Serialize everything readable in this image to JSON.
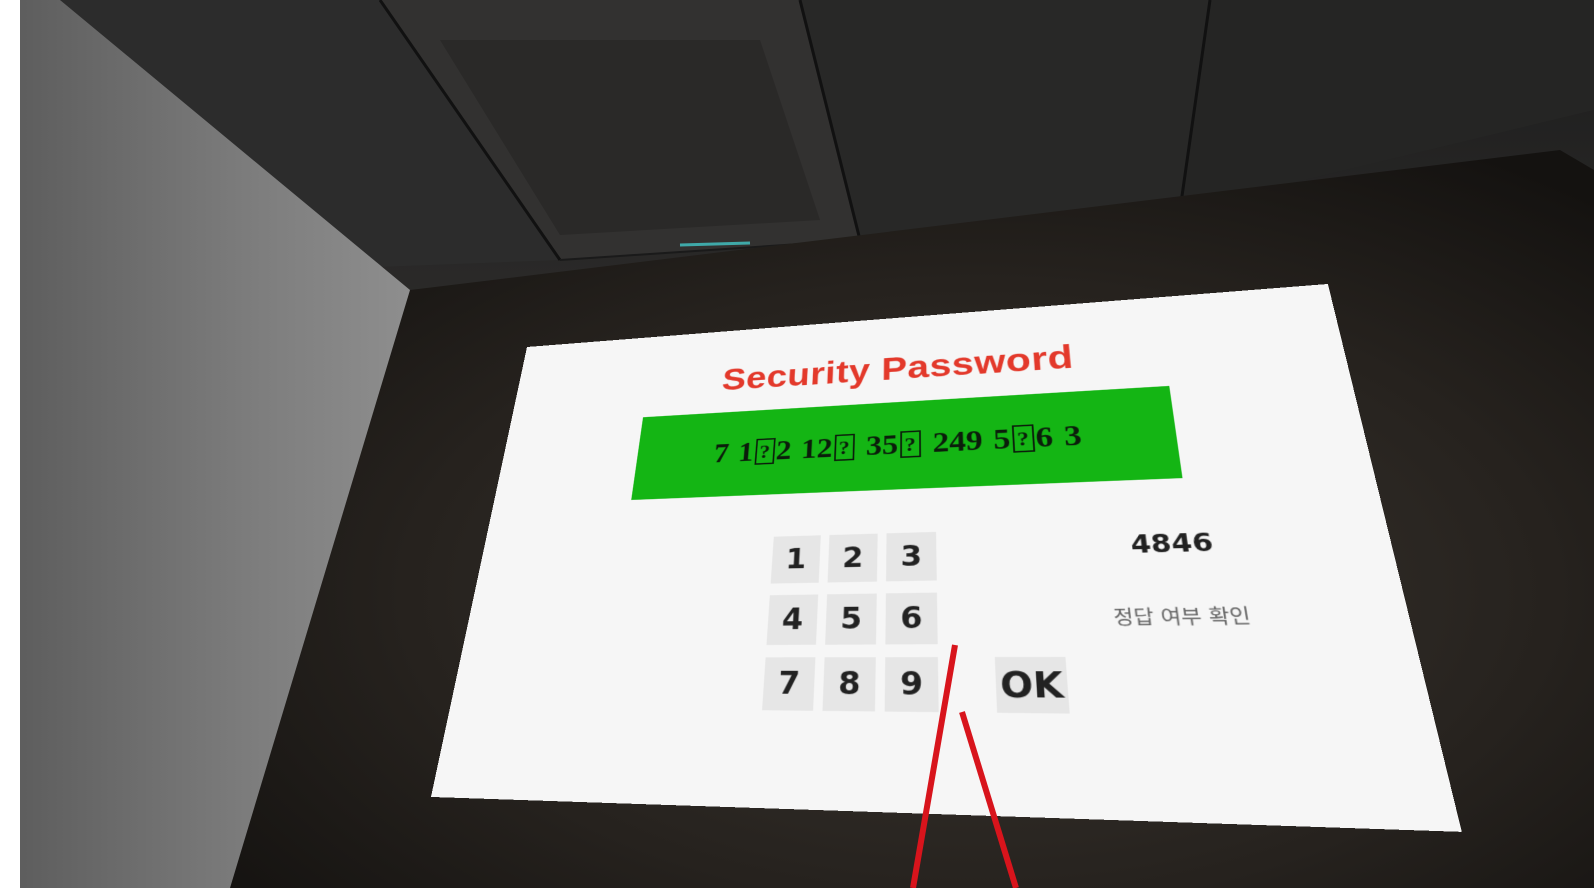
{
  "panel": {
    "title": "Security Password",
    "code_groups": [
      {
        "parts": [
          "7"
        ]
      },
      {
        "parts": [
          "1",
          "?",
          "2"
        ]
      },
      {
        "parts": [
          "12",
          "?"
        ]
      },
      {
        "parts": [
          "35",
          "?"
        ]
      },
      {
        "parts": [
          "249"
        ]
      },
      {
        "parts": [
          "5",
          "?",
          "6"
        ]
      },
      {
        "parts": [
          "3"
        ]
      }
    ],
    "keypad": {
      "k1": "1",
      "k2": "2",
      "k3": "3",
      "k4": "4",
      "k5": "5",
      "k6": "6",
      "k7": "7",
      "k8": "8",
      "k9": "9",
      "ok": "OK"
    },
    "answer_value": "4846",
    "check_label": "정답 여부 확인"
  },
  "colors": {
    "title": "#e3392b",
    "display": "#14b514",
    "panel": "#f6f6f6",
    "pointer_ray": "#d8141c"
  }
}
